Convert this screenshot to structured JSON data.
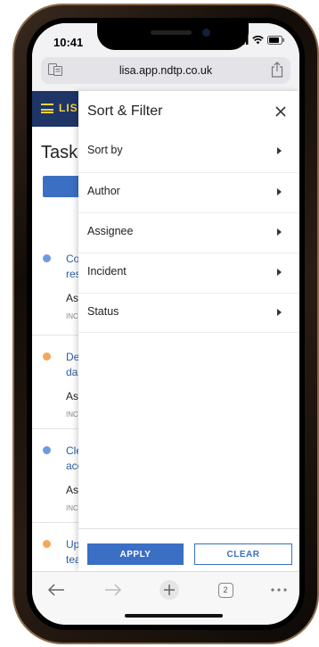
{
  "status_bar": {
    "time": "10:41"
  },
  "browser": {
    "url": "lisa.app.ndtp.co.uk",
    "tab_count": "2"
  },
  "page": {
    "logo": "LIS",
    "title": "Tasks",
    "tasks": [
      {
        "title_line1": "Co",
        "title_line2": "res",
        "assignee": "As",
        "incident": "INC",
        "dot_color": "#6f9ae0"
      },
      {
        "title_line1": "De",
        "title_line2": "dar",
        "assignee": "As",
        "incident": "INC",
        "dot_color": "#f3a75c"
      },
      {
        "title_line1": "Cle",
        "title_line2": "acc",
        "assignee": "As",
        "incident": "INC",
        "dot_color": "#6f9ae0"
      },
      {
        "title_line1": "Up",
        "title_line2": "tea",
        "assignee": "As",
        "incident": "INC",
        "dot_color": "#f3a75c"
      }
    ]
  },
  "drawer": {
    "title": "Sort & Filter",
    "items": [
      {
        "label": "Sort by"
      },
      {
        "label": "Author"
      },
      {
        "label": "Assignee"
      },
      {
        "label": "Incident"
      },
      {
        "label": "Status"
      }
    ],
    "apply_label": "APPLY",
    "clear_label": "CLEAR"
  },
  "colors": {
    "app_header": "#1e3566",
    "accent": "#3a6fc4",
    "logo": "#f4d23c"
  }
}
